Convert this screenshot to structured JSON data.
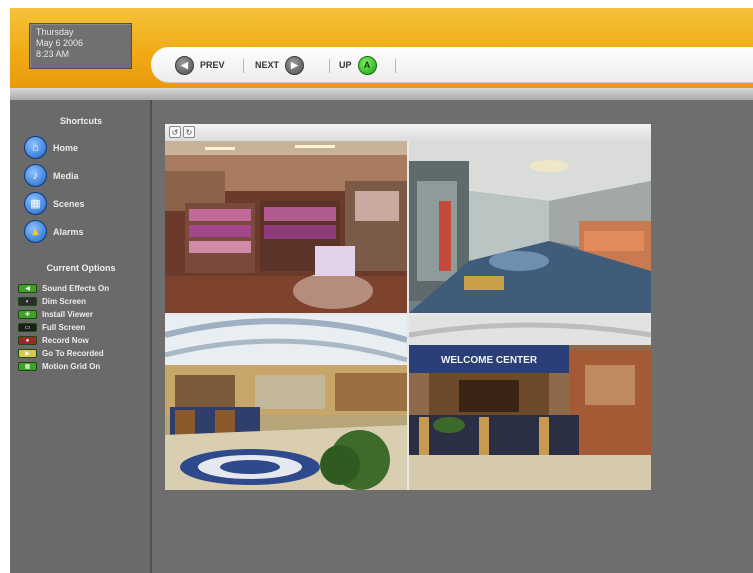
{
  "datetime": {
    "day": "Thursday",
    "date": "May 6 2006",
    "time": "8:23 AM"
  },
  "nav": {
    "prev": "PREV",
    "next": "NEXT",
    "up": "UP",
    "up_icon_letter": "A"
  },
  "sidebar": {
    "shortcuts_heading": "Shortcuts",
    "shortcuts": [
      {
        "label": "Home",
        "icon": "home-icon"
      },
      {
        "label": "Media",
        "icon": "speaker-icon"
      },
      {
        "label": "Scenes",
        "icon": "scenes-icon"
      },
      {
        "label": "Alarms",
        "icon": "warning-icon"
      }
    ],
    "options_heading": "Current Options",
    "options": [
      {
        "label": "Sound Effects On",
        "icon": "sound-effects-icon",
        "color": "#3fa02a"
      },
      {
        "label": "Dim Screen",
        "icon": "dim-screen-icon",
        "color": "#2b2b2b"
      },
      {
        "label": "Install Viewer",
        "icon": "install-icon",
        "color": "#3fa02a"
      },
      {
        "label": "Full Screen",
        "icon": "full-screen-icon",
        "color": "#1b1b1b"
      },
      {
        "label": "Record Now",
        "icon": "record-icon",
        "color": "#9a2a2a"
      },
      {
        "label": "Go To Recorded",
        "icon": "recorded-icon",
        "color": "#d9c94a"
      },
      {
        "label": "Motion Grid On",
        "icon": "motion-grid-icon",
        "color": "#3fa02a"
      }
    ]
  },
  "viewer": {
    "toolbar_icons": [
      "rotate-left-icon",
      "rotate-right-icon"
    ],
    "cameras": [
      {
        "name": "camera-gift-shop",
        "sign": ""
      },
      {
        "name": "camera-corridor",
        "sign": ""
      },
      {
        "name": "camera-lobby",
        "sign": ""
      },
      {
        "name": "camera-welcome-center",
        "sign": "WELCOME CENTER"
      }
    ]
  },
  "colors": {
    "accent": "#f0a914",
    "panel": "#6e6e6e",
    "nav_green": "#2fb21f"
  }
}
